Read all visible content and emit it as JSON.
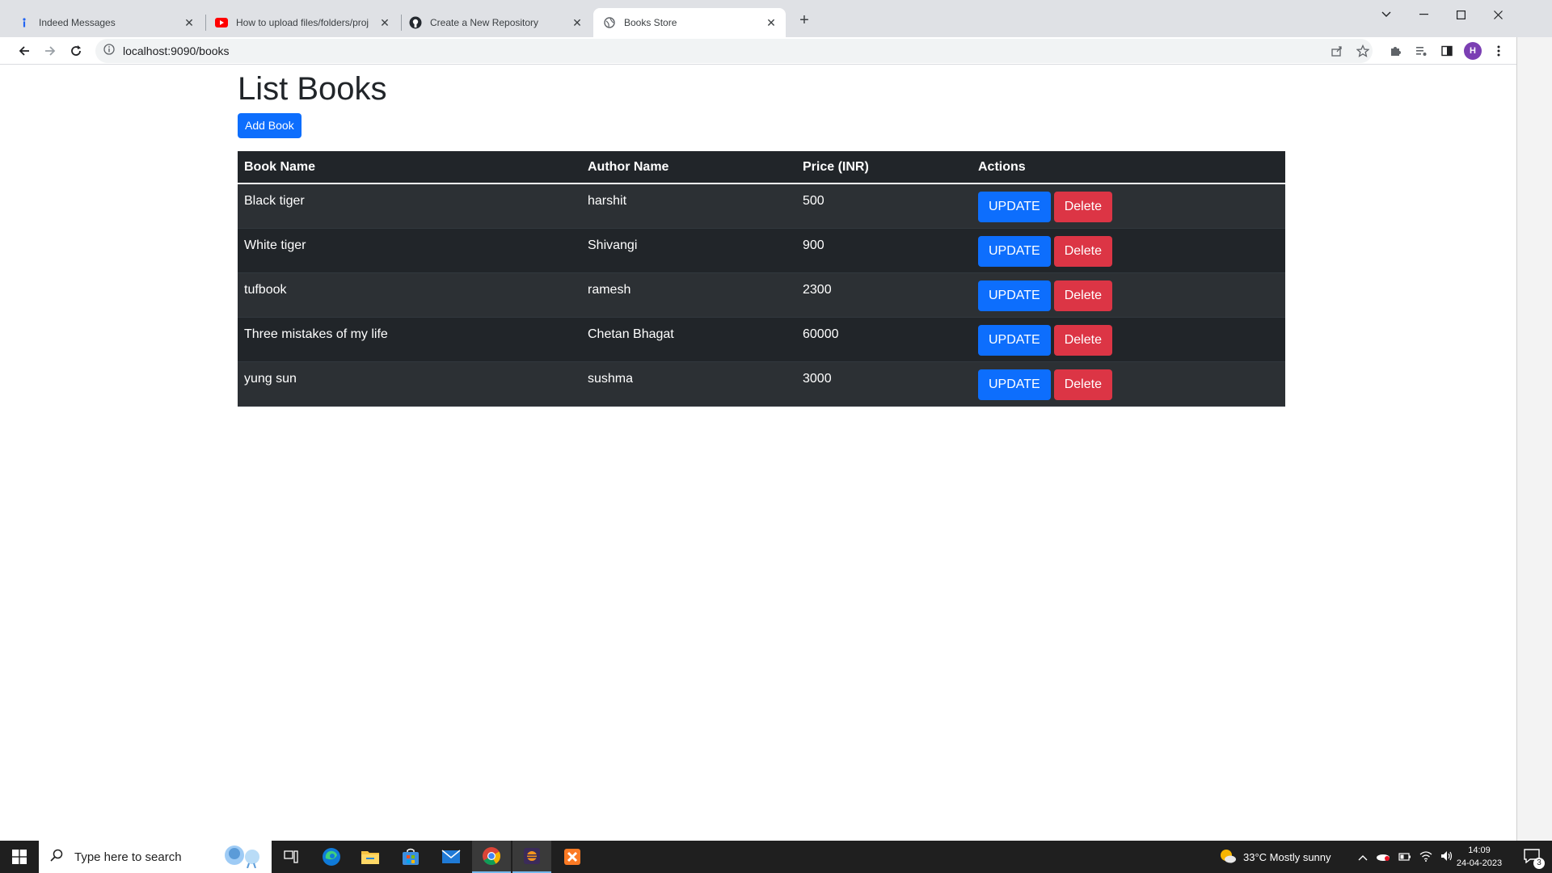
{
  "browser": {
    "tabs": [
      {
        "title": "Indeed Messages",
        "icon": "indeed-icon"
      },
      {
        "title": "How to upload files/folders/proj",
        "icon": "youtube-icon"
      },
      {
        "title": "Create a New Repository",
        "icon": "github-icon"
      },
      {
        "title": "Books Store",
        "icon": "globe-icon",
        "active": true
      }
    ],
    "url": "localhost:9090/books",
    "profile_initial": "H"
  },
  "page": {
    "title": "List Books",
    "add_button": "Add Book",
    "table": {
      "headers": [
        "Book Name",
        "Author Name",
        "Price (INR)",
        "Actions"
      ],
      "rows": [
        {
          "name": "Black tiger",
          "author": "harshit",
          "price": "500"
        },
        {
          "name": "White tiger",
          "author": "Shivangi",
          "price": "900"
        },
        {
          "name": "tufbook",
          "author": "ramesh",
          "price": "2300"
        },
        {
          "name": "Three mistakes of my life",
          "author": "Chetan Bhagat",
          "price": "60000"
        },
        {
          "name": "yung sun",
          "author": "sushma",
          "price": "3000"
        }
      ],
      "update_label": "UPDATE",
      "delete_label": "Delete"
    }
  },
  "taskbar": {
    "search_placeholder": "Type here to search",
    "weather": "33°C  Mostly sunny",
    "time": "14:09",
    "date": "24-04-2023",
    "notifications": "3"
  },
  "colors": {
    "primary": "#0d6efd",
    "danger": "#dc3545",
    "table_dark": "#212529",
    "table_stripe": "#2c3034"
  }
}
